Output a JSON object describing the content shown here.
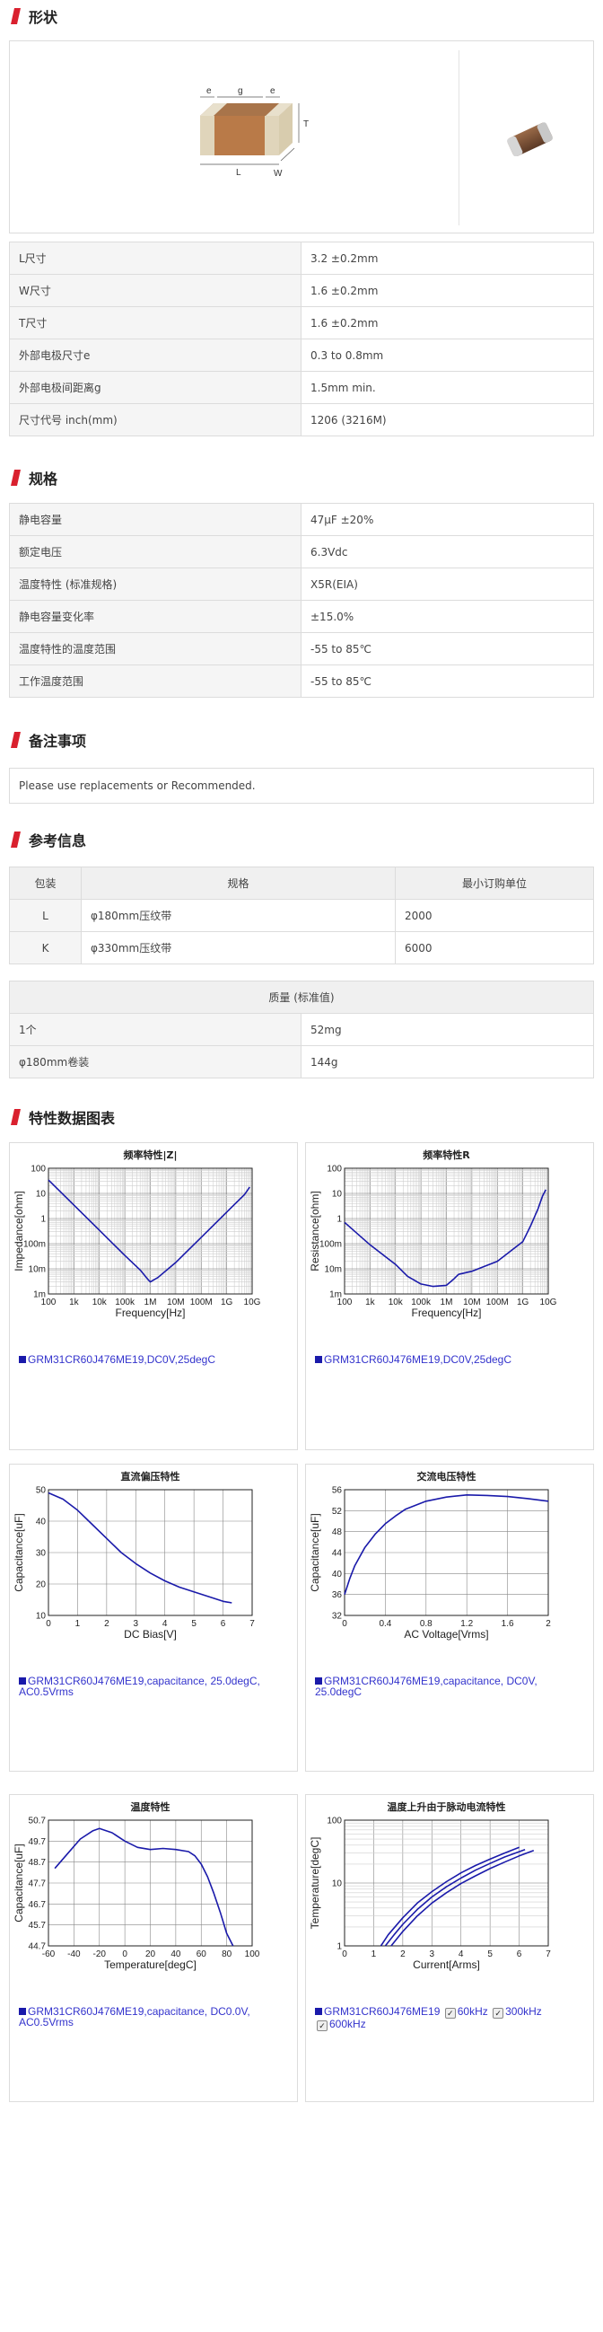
{
  "sections": {
    "shape": "形状",
    "spec": "规格",
    "notes": "备注事项",
    "reference": "参考信息",
    "charts": "特性数据图表"
  },
  "colors": {
    "accent": "#d9202e",
    "curve": "#1a1aaa",
    "legend_text": "#3333cc"
  },
  "shape_diagram": {
    "dim_e": "e",
    "dim_g": "g",
    "dim_t": "T",
    "dim_l": "L",
    "dim_w": "W"
  },
  "shape_table": [
    {
      "key": "L尺寸",
      "value": "3.2 ±0.2mm"
    },
    {
      "key": "W尺寸",
      "value": "1.6 ±0.2mm"
    },
    {
      "key": "T尺寸",
      "value": "1.6 ±0.2mm"
    },
    {
      "key": "外部电极尺寸e",
      "value": "0.3 to 0.8mm"
    },
    {
      "key": "外部电极间距离g",
      "value": "1.5mm min."
    },
    {
      "key": "尺寸代号 inch(mm)",
      "value": "1206 (3216M)"
    }
  ],
  "spec_table": [
    {
      "key": "静电容量",
      "value": "47μF ±20%"
    },
    {
      "key": "额定电压",
      "value": "6.3Vdc"
    },
    {
      "key": "温度特性 (标准规格)",
      "value": "X5R(EIA)"
    },
    {
      "key": "静电容量变化率",
      "value": "±15.0%"
    },
    {
      "key": "温度特性的温度范围",
      "value": "-55 to 85℃"
    },
    {
      "key": "工作温度范围",
      "value": "-55 to 85℃"
    }
  ],
  "notes_text": "Please use replacements or Recommended.",
  "packaging": {
    "headers": [
      "包装",
      "规格",
      "最小订购单位"
    ],
    "rows": [
      [
        "L",
        "φ180mm压纹带",
        "2000"
      ],
      [
        "K",
        "φ330mm压纹带",
        "6000"
      ]
    ]
  },
  "mass": {
    "header": "质量 (标准值)",
    "rows": [
      {
        "key": "1个",
        "value": "52mg"
      },
      {
        "key": "φ180mm卷装",
        "value": "144g"
      }
    ]
  },
  "chart_data": [
    {
      "type": "line",
      "title": "频率特性|Z|",
      "xlabel": "Frequency[Hz]",
      "ylabel": "Impedance[ohm]",
      "xscale": "log",
      "yscale": "log",
      "xlim": [
        100,
        10000000000
      ],
      "ylim": [
        0.001,
        100
      ],
      "xticks": [
        "100",
        "1k",
        "10k",
        "100k",
        "1M",
        "10M",
        "100M",
        "1G",
        "10G"
      ],
      "yticks": [
        "100",
        "10",
        "1",
        "100m",
        "10m",
        "1m"
      ],
      "grid": true,
      "series": [
        {
          "x": [
            100,
            1000,
            10000,
            100000,
            400000,
            800000,
            1000000,
            2000000,
            10000000,
            100000000,
            1000000000,
            5000000000,
            8000000000
          ],
          "y": [
            34,
            3.4,
            0.34,
            0.034,
            0.009,
            0.0038,
            0.003,
            0.0045,
            0.018,
            0.18,
            1.8,
            9,
            18
          ]
        }
      ],
      "legend": "GRM31CR60J476ME19,DC0V,25degC"
    },
    {
      "type": "line",
      "title": "频率特性R",
      "xlabel": "Frequency[Hz]",
      "ylabel": "Resistance[ohm]",
      "xscale": "log",
      "yscale": "log",
      "xlim": [
        100,
        10000000000
      ],
      "ylim": [
        0.001,
        100
      ],
      "xticks": [
        "100",
        "1k",
        "10k",
        "100k",
        "1M",
        "10M",
        "100M",
        "1G",
        "10G"
      ],
      "yticks": [
        "100",
        "10",
        "1",
        "100m",
        "10m",
        "1m"
      ],
      "grid": true,
      "series": [
        {
          "x": [
            100,
            1000,
            10000,
            30000,
            100000,
            300000,
            1000000,
            2000000,
            3000000,
            10000000,
            100000000,
            1000000000,
            2000000000,
            4000000000,
            6000000000,
            8000000000
          ],
          "y": [
            0.7,
            0.09,
            0.015,
            0.005,
            0.0025,
            0.002,
            0.0022,
            0.004,
            0.006,
            0.008,
            0.02,
            0.12,
            0.5,
            2.5,
            8,
            14
          ]
        }
      ],
      "legend": "GRM31CR60J476ME19,DC0V,25degC"
    },
    {
      "type": "line",
      "title": "直流偏压特性",
      "xlabel": "DC Bias[V]",
      "ylabel": "Capacitance[uF]",
      "xlim": [
        0,
        7
      ],
      "ylim": [
        10,
        50
      ],
      "xticks": [
        "0",
        "1",
        "2",
        "3",
        "4",
        "5",
        "6",
        "7"
      ],
      "yticks": [
        "50",
        "40",
        "30",
        "20",
        "10"
      ],
      "grid": true,
      "series": [
        {
          "x": [
            0,
            0.5,
            1,
            1.5,
            2,
            2.5,
            3,
            3.5,
            4,
            4.5,
            5,
            5.5,
            6,
            6.3
          ],
          "y": [
            49,
            47,
            43.5,
            39,
            34.5,
            30,
            26.5,
            23.5,
            21,
            19,
            17.5,
            16,
            14.5,
            14
          ]
        }
      ],
      "legend": "GRM31CR60J476ME19,capacitance, 25.0degC, AC0.5Vrms"
    },
    {
      "type": "line",
      "title": "交流电压特性",
      "xlabel": "AC Voltage[Vrms]",
      "ylabel": "Capacitance[uF]",
      "xlim": [
        0,
        2
      ],
      "ylim": [
        32,
        56
      ],
      "xticks": [
        "0",
        "0.4",
        "0.8",
        "1.2",
        "1.6",
        "2"
      ],
      "yticks": [
        "56",
        "52",
        "48",
        "44",
        "40",
        "36",
        "32"
      ],
      "grid": true,
      "series": [
        {
          "x": [
            0,
            0.05,
            0.1,
            0.2,
            0.3,
            0.4,
            0.5,
            0.6,
            0.8,
            1.0,
            1.2,
            1.4,
            1.6,
            1.8,
            2.0
          ],
          "y": [
            36,
            39,
            41.5,
            45,
            47.5,
            49.5,
            51,
            52.3,
            53.8,
            54.6,
            55,
            54.9,
            54.7,
            54.3,
            53.8
          ]
        }
      ],
      "legend": "GRM31CR60J476ME19,capacitance, DC0V, 25.0degC"
    },
    {
      "type": "line",
      "title": "温度特性",
      "xlabel": "Temperature[degC]",
      "ylabel": "Capacitance[uF]",
      "xlim": [
        -60,
        100
      ],
      "ylim": [
        44.7,
        50.7
      ],
      "xticks": [
        "-60",
        "-40",
        "-20",
        "0",
        "20",
        "40",
        "60",
        "80",
        "100"
      ],
      "yticks": [
        "50.7",
        "49.7",
        "48.7",
        "47.7",
        "46.7",
        "45.7",
        "44.7"
      ],
      "grid": true,
      "series": [
        {
          "x": [
            -55,
            -45,
            -35,
            -25,
            -20,
            -10,
            0,
            10,
            20,
            30,
            40,
            50,
            55,
            60,
            65,
            70,
            75,
            80,
            85
          ],
          "y": [
            48.4,
            49.1,
            49.8,
            50.2,
            50.3,
            50.1,
            49.7,
            49.4,
            49.3,
            49.35,
            49.3,
            49.2,
            49.0,
            48.6,
            48.0,
            47.2,
            46.3,
            45.3,
            44.7
          ]
        }
      ],
      "legend": "GRM31CR60J476ME19,capacitance, DC0.0V, AC0.5Vrms"
    },
    {
      "type": "line",
      "title": "温度上升由于脉动电流特性",
      "xlabel": "Current[Arms]",
      "ylabel": "Temperature[degC]",
      "yscale": "log",
      "xlim": [
        0,
        7
      ],
      "ylim": [
        1,
        100
      ],
      "xticks": [
        "0",
        "1",
        "2",
        "3",
        "4",
        "5",
        "6",
        "7"
      ],
      "yticks": [
        "100",
        "10",
        "1"
      ],
      "grid": true,
      "series": [
        {
          "name": "60kHz",
          "x": [
            1.25,
            1.5,
            2,
            2.5,
            3,
            3.5,
            4,
            4.5,
            5,
            5.5,
            6
          ],
          "y": [
            1,
            1.5,
            2.8,
            4.8,
            7.3,
            10.5,
            14.5,
            19,
            24,
            30,
            37
          ]
        },
        {
          "name": "300kHz",
          "x": [
            1.4,
            1.7,
            2,
            2.5,
            3,
            3.5,
            4,
            4.5,
            5,
            5.5,
            6.2
          ],
          "y": [
            1,
            1.5,
            2.2,
            3.8,
            6,
            8.7,
            12,
            16,
            20.5,
            26,
            34
          ]
        },
        {
          "name": "600kHz",
          "x": [
            1.6,
            2,
            2.5,
            3,
            3.5,
            4,
            4.5,
            5,
            5.5,
            6,
            6.5
          ],
          "y": [
            1,
            1.7,
            3,
            4.8,
            7,
            9.8,
            13,
            17,
            21.5,
            27,
            33
          ]
        }
      ],
      "legend": "GRM31CR60J476ME19"
    }
  ]
}
